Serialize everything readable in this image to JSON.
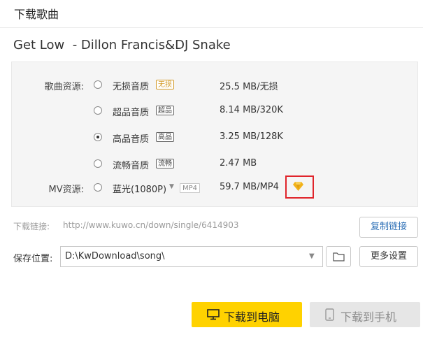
{
  "window": {
    "title": "下载歌曲"
  },
  "song": {
    "title": "Get Low  - Dillon Francis&DJ Snake"
  },
  "sources": {
    "song_label": "歌曲资源:",
    "options": [
      {
        "name": "无损音质",
        "badge": "无损",
        "size": "25.5 MB/无损",
        "selected": false
      },
      {
        "name": "超品音质",
        "badge": "超品",
        "size": "8.14 MB/320K",
        "selected": false
      },
      {
        "name": "高品音质",
        "badge": "高品",
        "size": "3.25 MB/128K",
        "selected": true
      },
      {
        "name": "流畅音质",
        "badge": "流畅",
        "size": "2.47 MB",
        "selected": false
      }
    ],
    "mv_label": "MV资源:",
    "mv": {
      "name": "蓝光(1080P)",
      "format": "MP4",
      "size": "59.7 MB/MP4",
      "vip_icon": "diamond-icon"
    }
  },
  "link": {
    "label": "下载链接:",
    "url": "http://www.kuwo.cn/down/single/6414903",
    "copy_button": "复制链接"
  },
  "save": {
    "label": "保存位置:",
    "path": "D:\\KwDownload\\song\\",
    "more_button": "更多设置"
  },
  "actions": {
    "download_pc": "下载到电脑",
    "download_phone": "下载到手机"
  },
  "colors": {
    "primary": "#ffd200",
    "vip_highlight": "#e0242b",
    "disabled": "#e6e6e6",
    "vip_diamond": "#f2b21a"
  }
}
